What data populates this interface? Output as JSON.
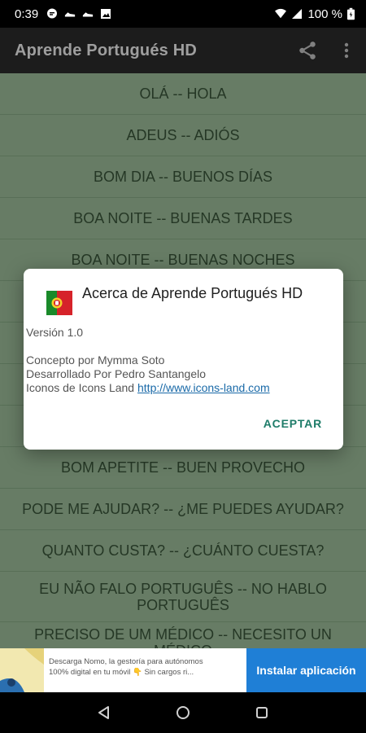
{
  "status_bar": {
    "time": "0:39",
    "battery": "100 %"
  },
  "app_bar": {
    "title": "Aprende Portugués HD"
  },
  "list": {
    "items": [
      "OLÁ -- HOLA",
      "ADEUS -- ADIÓS",
      "BOM DIA -- BUENOS DÍAS",
      "BOA NOITE -- BUENAS TARDES",
      "BOA NOITE -- BUENAS NOCHES",
      "",
      "",
      "",
      "",
      "BOM APETITE -- BUEN PROVECHO",
      "PODE ME AJUDAR? -- ¿ME PUEDES AYUDAR?",
      "QUANTO CUSTA? -- ¿CUÁNTO CUESTA?",
      "EU NÃO FALO PORTUGUÊS -- NO HABLO PORTUGUÊS",
      "PRECISO DE UM MÉDICO -- NECESITO UN MÉDICO"
    ]
  },
  "dialog": {
    "title": "Acerca de Aprende Portugués HD",
    "version": "Versión 1.0",
    "concept": "Concepto por Mymma Soto",
    "developer": "Desarrollado Por Pedro Santangelo",
    "icons_prefix": "Iconos de Icons Land ",
    "icons_link": "http://www.icons-land.com",
    "accept": "ACEPTAR"
  },
  "ad": {
    "line1": "Descarga Nomo, la gestoría para autónomos",
    "line2": "100% digital en tu móvil 👇 Sin cargos ri...",
    "cta": "Instalar aplicación"
  },
  "colors": {
    "list_bg": "#a6c9a4",
    "app_bar": "#2e2e2e",
    "accent": "#1e7c69",
    "ad_button": "#1f7fd6"
  },
  "icons": [
    "share-icon",
    "more-vert-icon",
    "portugal-flag-icon",
    "back-icon",
    "home-icon",
    "recents-icon"
  ]
}
